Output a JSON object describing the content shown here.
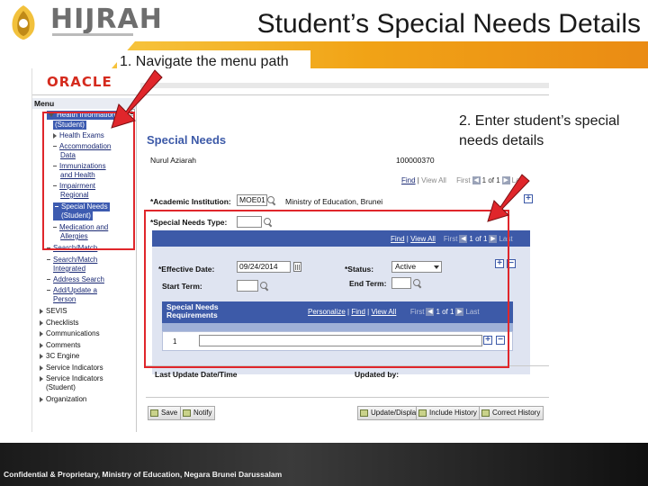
{
  "slide": {
    "logo_text": "HIJRAH",
    "title": "Student’s Special Needs Details",
    "step1": "1. Navigate the menu path",
    "step2": "2. Enter student’s special needs details",
    "footer": "Confidential & Proprietary, Ministry of Education, Negara Brunei Darussalam"
  },
  "app": {
    "brand": "ORACLE",
    "menu": {
      "header": "Menu",
      "items": [
        {
          "label": "Health Information",
          "type": "folder-open",
          "selected": true
        },
        {
          "label": "(Student)",
          "type": "text",
          "selected": true
        },
        {
          "label": "Health Exams",
          "type": "folder"
        },
        {
          "label": "Accommodation",
          "type": "link"
        },
        {
          "label": "Data",
          "type": "cont"
        },
        {
          "label": "Immunizations",
          "type": "link"
        },
        {
          "label": "and Health",
          "type": "cont"
        },
        {
          "label": "Impairment",
          "type": "link"
        },
        {
          "label": "Regional",
          "type": "cont"
        },
        {
          "label": "Special Needs",
          "type": "link",
          "selected": true
        },
        {
          "label": "(Student)",
          "type": "cont",
          "selected": true
        },
        {
          "label": "Medication and",
          "type": "link"
        },
        {
          "label": "Allergies",
          "type": "cont"
        },
        {
          "label": "Search/Match",
          "type": "link"
        },
        {
          "label": "Search/Match",
          "type": "link"
        },
        {
          "label": "Integrated",
          "type": "cont"
        },
        {
          "label": "Address Search",
          "type": "link"
        },
        {
          "label": "Add/Update a",
          "type": "link"
        },
        {
          "label": "Person",
          "type": "cont"
        },
        {
          "label": "SEVIS",
          "type": "folder"
        },
        {
          "label": "Checklists",
          "type": "folder"
        },
        {
          "label": "Communications",
          "type": "folder"
        },
        {
          "label": "Comments",
          "type": "folder"
        },
        {
          "label": "3C Engine",
          "type": "folder"
        },
        {
          "label": "Service Indicators",
          "type": "folder"
        },
        {
          "label": "Service Indicators",
          "type": "folder"
        },
        {
          "label": "(Student)",
          "type": "cont"
        },
        {
          "label": "Organization",
          "type": "folder"
        }
      ]
    },
    "page": {
      "title": "Special Needs",
      "student_name": "Nurul Aziarah",
      "student_id": "100000370",
      "top_nav": {
        "find": "Find",
        "view_all": "View All",
        "first": "First",
        "count": "1 of 1",
        "last": "Last"
      },
      "academic_institution_label": "*Academic Institution:",
      "academic_institution_value": "MOE01",
      "academic_institution_desc": "Ministry of Education, Brunei",
      "special_needs_type_label": "*Special Needs Type:",
      "special_needs_type_value": "",
      "inner_nav": {
        "find": "Find",
        "view_all": "View All",
        "first": "First",
        "count": "1 of 1",
        "last": "Last"
      },
      "effective_date_label": "*Effective Date:",
      "effective_date_value": "09/24/2014",
      "status_label": "*Status:",
      "status_value": "Active",
      "start_term_label": "Start Term:",
      "end_term_label": "End Term:",
      "requirements": {
        "title_line1": "Special Needs",
        "title_line2": "Requirements",
        "personalize": "Personalize",
        "find": "Find",
        "view_all": "View All",
        "first": "First",
        "count": "1 of 1",
        "last": "Last",
        "row_number": "1",
        "row_value": ""
      },
      "last_update_label": "Last Update Date/Time",
      "updated_by_label": "Updated by:",
      "buttons": {
        "save": "Save",
        "notify": "Notify",
        "update_display": "Update/Display",
        "include_history": "Include History",
        "correct_history": "Correct History"
      }
    }
  },
  "colors": {
    "oracle_red": "#d52b1e",
    "ps_blue": "#3d5aa8",
    "annotation_red": "#e0262b",
    "band_orange": "#f1a316"
  }
}
